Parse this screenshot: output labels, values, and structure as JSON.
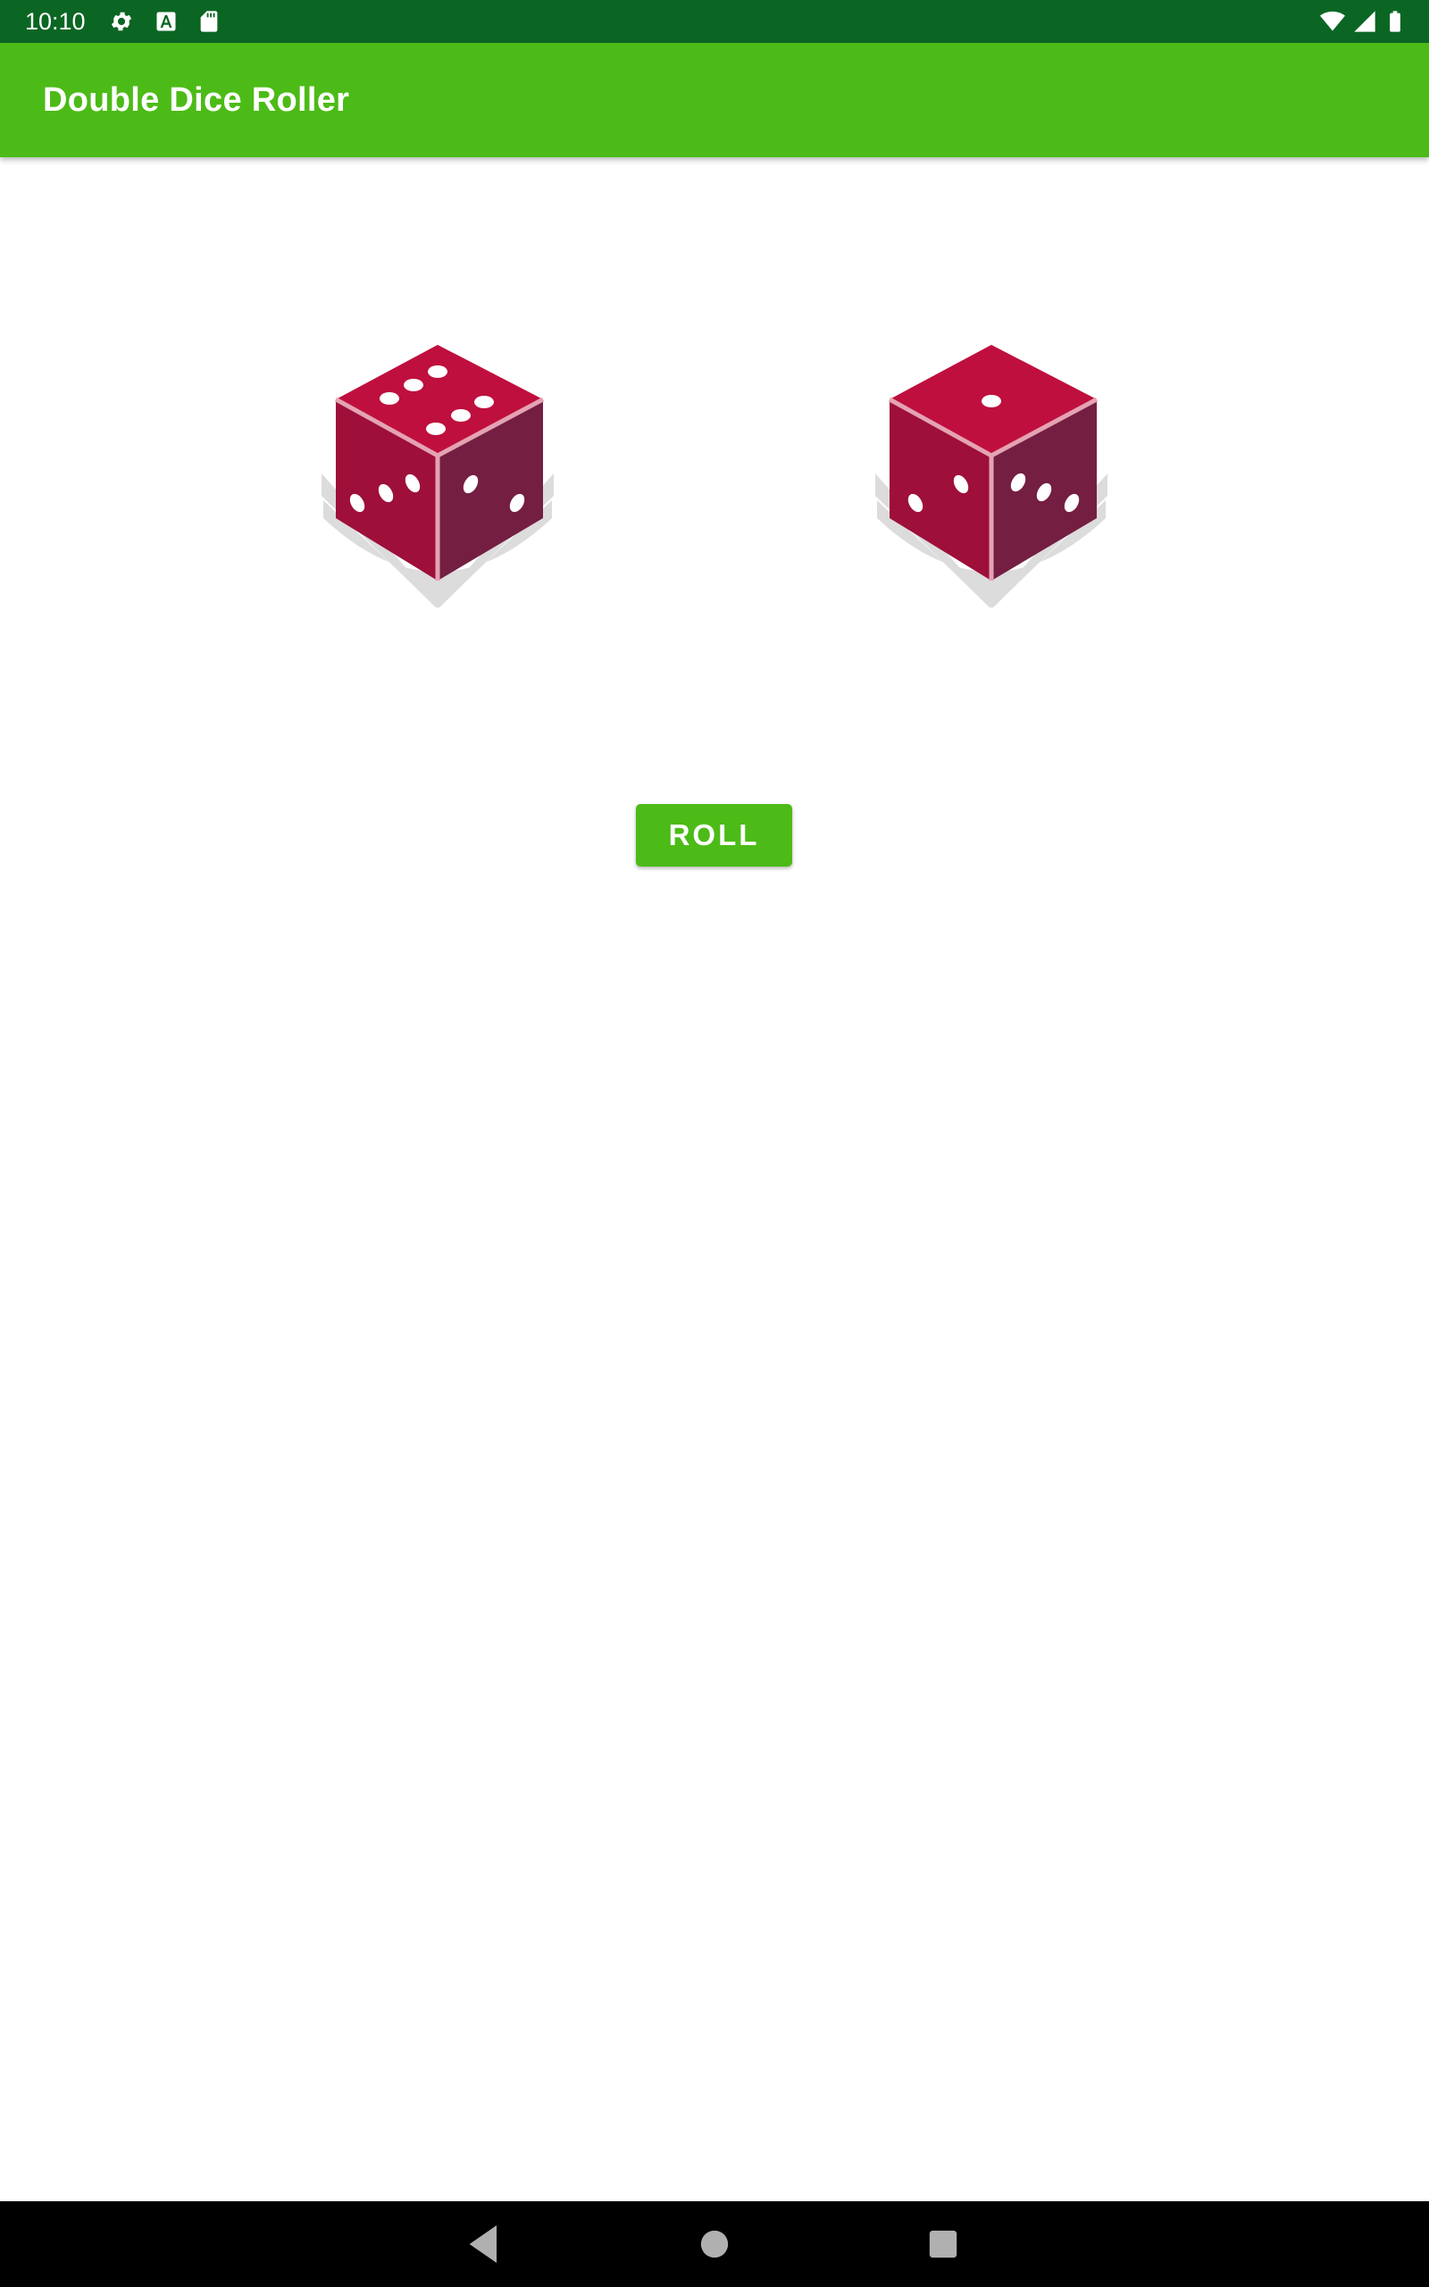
{
  "status_bar": {
    "time": "10:10",
    "left_icons": [
      "gear-icon",
      "font-download-icon",
      "sd-card-icon"
    ],
    "right_icons": [
      "wifi-icon",
      "signal-icon",
      "battery-icon"
    ],
    "background": "#0b6623"
  },
  "app_bar": {
    "title": "Double Dice Roller",
    "background": "#4cbb17"
  },
  "dice": [
    {
      "name": "dice-left",
      "top_face": 6,
      "left_face": 3,
      "right_face": 2
    },
    {
      "name": "dice-right",
      "top_face": 1,
      "left_face": 2,
      "right_face": 3
    }
  ],
  "roll_button": {
    "label": "ROLL",
    "background": "#4cbb17"
  },
  "nav_bar": {
    "buttons": [
      "back-icon",
      "home-icon",
      "recents-icon"
    ]
  },
  "colors": {
    "dice_top": "#bf0f3e",
    "dice_left": "#9e0f3a",
    "dice_right": "#741e42",
    "dice_edge": "#e4a3b3",
    "dice_shadow": "#dcdcdc"
  }
}
